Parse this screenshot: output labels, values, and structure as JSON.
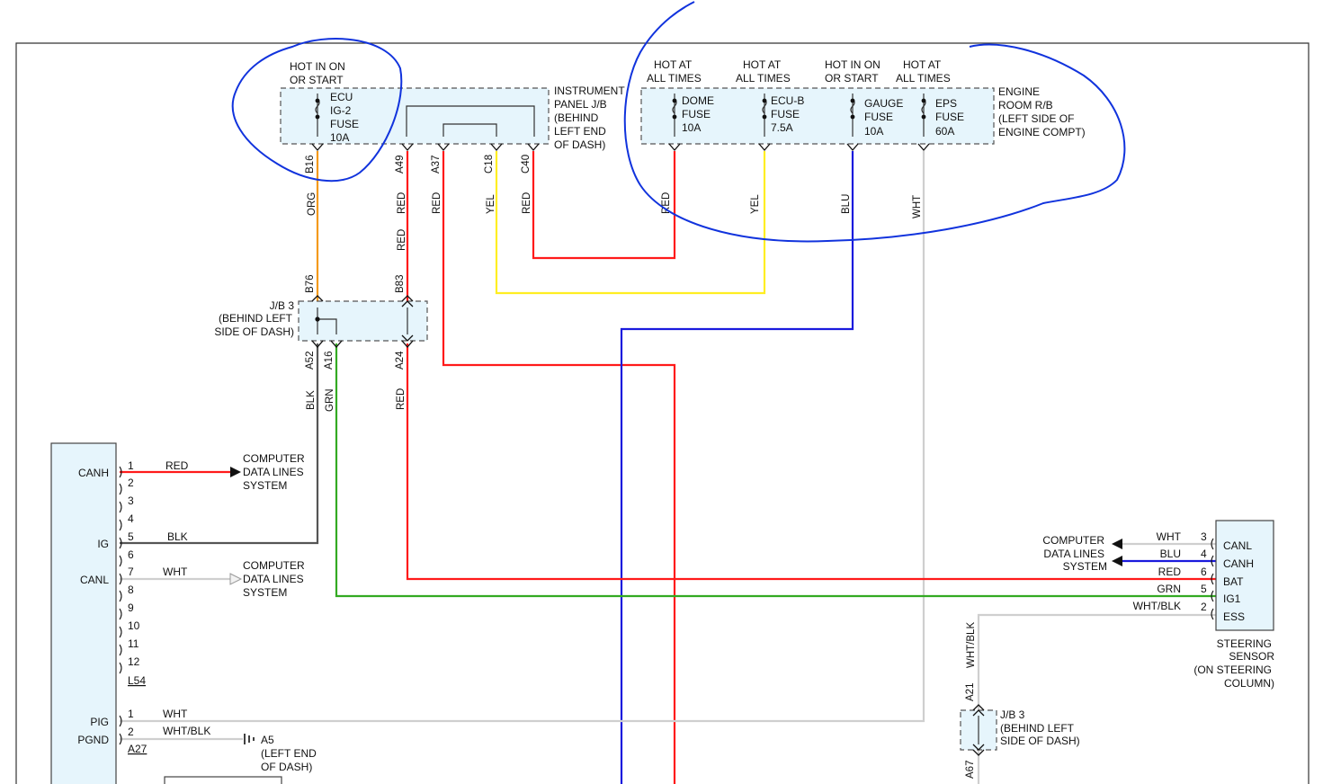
{
  "instrument_panel": {
    "label": [
      "INSTRUMENT",
      "PANEL J/B",
      "(BEHIND",
      "LEFT END",
      "OF DASH)"
    ],
    "power_label": [
      "HOT IN ON",
      "OR START"
    ],
    "fuse": [
      "ECU",
      "IG-2",
      "FUSE",
      "10A"
    ],
    "pins": [
      "B16",
      "A49",
      "A37",
      "C18",
      "C40"
    ]
  },
  "engine_room": {
    "label": [
      "ENGINE",
      "ROOM R/B",
      "(LEFT SIDE OF",
      "ENGINE COMPT)"
    ],
    "fuses": [
      {
        "power": [
          "HOT AT",
          "ALL TIMES"
        ],
        "lines": [
          "DOME",
          "FUSE",
          "10A"
        ]
      },
      {
        "power": [
          "HOT AT",
          "ALL TIMES"
        ],
        "lines": [
          "ECU-B",
          "FUSE",
          "7.5A"
        ]
      },
      {
        "power": [
          "HOT IN ON",
          "OR START"
        ],
        "lines": [
          "GAUGE",
          "FUSE",
          "10A"
        ]
      },
      {
        "power": [
          "HOT AT",
          "ALL TIMES"
        ],
        "lines": [
          "EPS",
          "FUSE",
          "60A"
        ]
      }
    ]
  },
  "wire_colors": {
    "b16": "ORG",
    "a49": "RED",
    "a37": "RED",
    "c18": "YEL",
    "c40": "RED",
    "dome": "RED",
    "ecub": "YEL",
    "gauge": "BLU",
    "eps": "WHT",
    "a52": "BLK",
    "a16": "GRN",
    "a24": "RED",
    "a21": "WHT/BLK"
  },
  "jb3_top": {
    "label": [
      "J/B 3",
      "(BEHIND LEFT",
      "SIDE OF DASH)"
    ],
    "pins": [
      "B76",
      "B83",
      "A52",
      "A16",
      "A24"
    ]
  },
  "jb3_bottom": {
    "label": [
      "J/B 3",
      "(BEHIND LEFT",
      "SIDE OF DASH)"
    ],
    "pins": [
      "A21",
      "A67"
    ]
  },
  "module": {
    "connector": "L54",
    "connector2": "A27",
    "names": {
      "canh": "CANH",
      "ig": "IG",
      "canl": "CANL",
      "pig": "PIG",
      "pgnd": "PGND"
    },
    "pins": [
      "1",
      "2",
      "3",
      "4",
      "5",
      "6",
      "7",
      "8",
      "9",
      "10",
      "11",
      "12"
    ],
    "pins2": [
      "1",
      "2"
    ],
    "wires": {
      "p1": "RED",
      "p5": "BLK",
      "p7": "WHT",
      "pig": "WHT",
      "pgnd": "WHT/BLK"
    },
    "ground": [
      "A5",
      "(LEFT END",
      "OF DASH)"
    ]
  },
  "cdl_text": [
    "COMPUTER",
    "DATA LINES",
    "SYSTEM"
  ],
  "steering": {
    "label": [
      "STEERING",
      "SENSOR",
      "(ON STEERING",
      "COLUMN)"
    ],
    "terminals": [
      "CANL",
      "CANH",
      "BAT",
      "IG1",
      "ESS"
    ],
    "pins": [
      "3",
      "4",
      "6",
      "5",
      "2"
    ],
    "wires": [
      "WHT",
      "BLU",
      "RED",
      "GRN",
      "WHT/BLK"
    ]
  },
  "colors": {
    "orange": "#f39a1c",
    "red": "#ff1a1a",
    "yellow": "#ffee22",
    "blue": "#1a1add",
    "green": "#33aa22",
    "white_wire": "#cfcfcf",
    "black_wire": "#555555",
    "box_fill": "#e6f5fc",
    "pen_annotation": "#1133dd"
  }
}
